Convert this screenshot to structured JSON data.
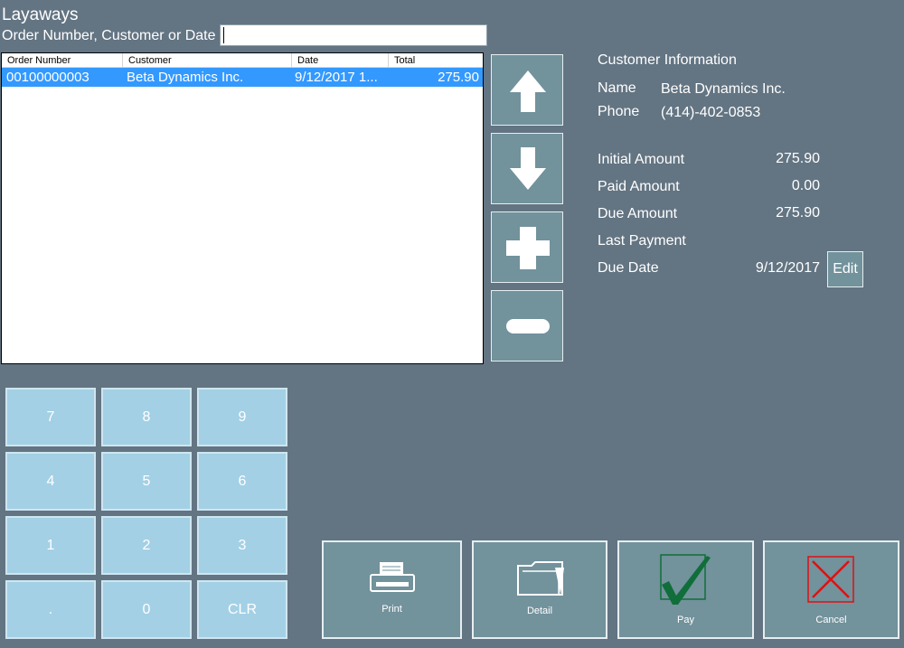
{
  "header": {
    "title": "Layaways",
    "search_label": "Order Number, Customer or Date",
    "search_value": ""
  },
  "order_list": {
    "columns": [
      "Order Number",
      "Customer",
      "Date",
      "Total"
    ],
    "rows": [
      {
        "order_number": "00100000003",
        "customer": "Beta Dynamics Inc.",
        "date": "9/12/2017 1...",
        "total": "275.90"
      }
    ]
  },
  "customer_info": {
    "heading": "Customer Information",
    "name_label": "Name",
    "name_value": "Beta Dynamics Inc.",
    "phone_label": "Phone",
    "phone_value": "(414)-402-0853",
    "initial_amount_label": "Initial Amount",
    "initial_amount_value": "275.90",
    "paid_amount_label": "Paid Amount",
    "paid_amount_value": "0.00",
    "due_amount_label": "Due Amount",
    "due_amount_value": "275.90",
    "last_payment_label": "Last Payment",
    "last_payment_value": "",
    "due_date_label": "Due Date",
    "due_date_value": "9/12/2017",
    "edit_label": "Edit"
  },
  "side_buttons": [
    "arrow-up-icon",
    "arrow-down-icon",
    "plus-icon",
    "minus-icon"
  ],
  "keypad": {
    "keys": [
      "7",
      "8",
      "9",
      "4",
      "5",
      "6",
      "1",
      "2",
      "3",
      ".",
      "0",
      "CLR"
    ]
  },
  "actions": {
    "print": "Print",
    "detail": "Detail",
    "pay": "Pay",
    "cancel": "Cancel"
  },
  "colors": {
    "background": "#637482",
    "button": "#72929c",
    "keypad": "#a3d0e5",
    "selection": "#3399ff",
    "pay_check": "#0f6e3a",
    "cancel_x": "#e01010"
  }
}
